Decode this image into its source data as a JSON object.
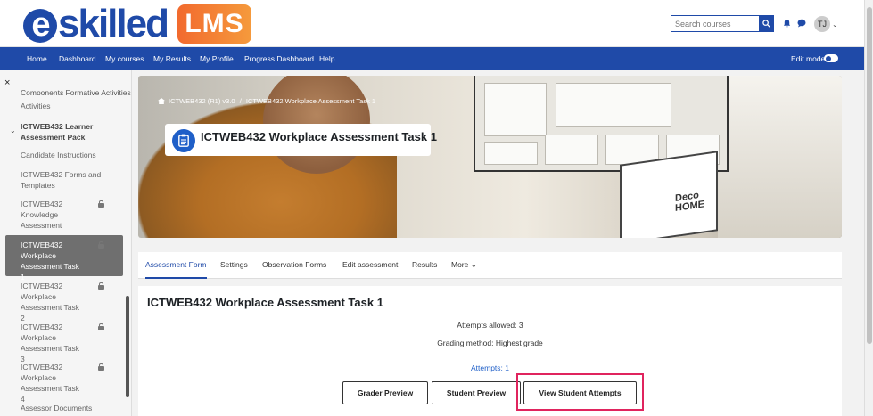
{
  "brand": {
    "logo_e": "e",
    "logo_rest": "skilled",
    "badge": "LMS"
  },
  "header": {
    "search_placeholder": "Search courses",
    "avatar_initials": "TJ",
    "avatar_caret": "⌄"
  },
  "nav": {
    "items": [
      "Home",
      "Dashboard",
      "My courses",
      "My Results",
      "My Profile",
      "Progress Dashboard",
      "Help"
    ],
    "edit_mode_label": "Edit mode"
  },
  "sidebar": {
    "close_glyph": "×",
    "cut_item": "Components Formative Activities",
    "activities_label": "Activities",
    "section_title": "ICTWEB432 Learner Assessment Pack",
    "items": [
      {
        "label": "Candidate Instructions",
        "locked": false
      },
      {
        "label": "ICTWEB432 Forms and Templates",
        "locked": false
      },
      {
        "label": "ICTWEB432 Knowledge Assessment",
        "locked": true
      },
      {
        "label": "ICTWEB432 Workplace Assessment Task 1",
        "locked": true,
        "active": true
      },
      {
        "label": "ICTWEB432 Workplace Assessment Task 2",
        "locked": true
      },
      {
        "label": "ICTWEB432 Workplace Assessment Task 3",
        "locked": true
      },
      {
        "label": "ICTWEB432 Workplace Assessment Task 4",
        "locked": true
      },
      {
        "label": "Assessor Documents",
        "locked": false
      }
    ]
  },
  "banner": {
    "breadcrumb_course": "ICTWEB432 (R1) v3.0",
    "breadcrumb_sep": "/",
    "breadcrumb_page": "ICTWEB432 Workplace Assessment Task 1",
    "page_title": "ICTWEB432 Workplace Assessment Task 1",
    "laptop_text_1": "Deco",
    "laptop_text_2": "HOME"
  },
  "tabs": [
    "Assessment Form",
    "Settings",
    "Observation Forms",
    "Edit assessment",
    "Results",
    "More"
  ],
  "tabs_more_caret": "⌄",
  "content": {
    "title": "ICTWEB432 Workplace Assessment Task 1",
    "attempts_allowed": "Attempts allowed: 3",
    "grading_method": "Grading method: Highest grade",
    "attempts_link": "Attempts: 1",
    "buttons": {
      "grader_preview": "Grader Preview",
      "student_preview": "Student Preview",
      "view_attempts": "View Student Attempts"
    }
  },
  "colors": {
    "brand_blue": "#1f4aa8",
    "badge_orange": "#f26a2e",
    "highlight": "#e0245e"
  }
}
